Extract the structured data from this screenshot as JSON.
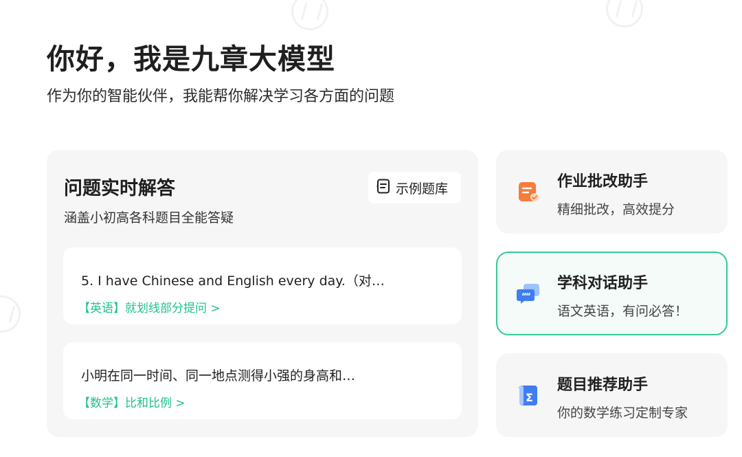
{
  "hero": {
    "title": "你好，我是九章大模型",
    "subtitle": "作为你的智能伙伴，我能帮你解决学习各方面的问题"
  },
  "qa_panel": {
    "title": "问题实时解答",
    "subtitle": "涵盖小初高各科题目全能答疑",
    "example_button": {
      "icon": "question-bank-icon",
      "label": "示例题库"
    },
    "questions": [
      {
        "text": "5. I have Chinese and English every day.（对…",
        "tag": "【英语】就划线部分提问 >"
      },
      {
        "text": "小明在同一时间、同一地点测得小强的身高和…",
        "tag": "【数学】比和比例 >"
      }
    ],
    "tag_color": "#1ec28b"
  },
  "assistants": [
    {
      "icon": "homework-grading-icon",
      "title": "作业批改助手",
      "subtitle": "精细批改，高效提分",
      "selected": false
    },
    {
      "icon": "chat-bubbles-icon",
      "title": "学科对话助手",
      "subtitle": "语文英语，有问必答！",
      "selected": true
    },
    {
      "icon": "sigma-book-icon",
      "title": "题目推荐助手",
      "subtitle": "你的数学练习定制专家",
      "selected": false
    }
  ],
  "colors": {
    "accent": "#33c89a",
    "orange": "#f57c3b",
    "blue": "#3f7df0"
  }
}
